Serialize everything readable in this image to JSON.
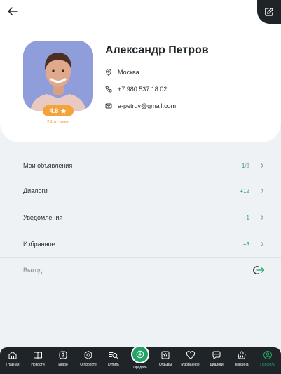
{
  "header": {
    "back_icon": "arrow-left-icon",
    "edit_icon": "edit-icon"
  },
  "profile": {
    "name": "Александр Петров",
    "rating": "4.8",
    "reviews": "24 отзыва",
    "city": "Москва",
    "phone": "+7 980 537 18 02",
    "email": "a-petrov@gmail.com"
  },
  "menu": {
    "items": [
      {
        "label": "Мои объявления",
        "count_active": "1",
        "count_rest": "/3"
      },
      {
        "label": "Диалоги",
        "count_active": "+12",
        "count_rest": ""
      },
      {
        "label": "Уведомления",
        "count_active": "+1",
        "count_rest": ""
      },
      {
        "label": "Избранное",
        "count_active": "+3",
        "count_rest": ""
      }
    ],
    "logout_label": "Выход"
  },
  "nav": {
    "items": [
      {
        "label": "Главная",
        "icon": "home-icon"
      },
      {
        "label": "Новости",
        "icon": "news-icon"
      },
      {
        "label": "Инфо",
        "icon": "info-icon"
      },
      {
        "label": "О проекте",
        "icon": "about-icon"
      },
      {
        "label": "Купить",
        "icon": "buy-search-icon"
      },
      {
        "label": "Отзывы",
        "icon": "reviews-icon"
      },
      {
        "label": "Избранное",
        "icon": "heart-icon"
      },
      {
        "label": "Диалоги",
        "icon": "chat-icon"
      },
      {
        "label": "Корзина",
        "icon": "cart-icon"
      },
      {
        "label": "Профиль",
        "icon": "profile-icon"
      }
    ],
    "sell_label": "Продать",
    "active": "Профиль"
  },
  "colors": {
    "accent": "#21a366",
    "rating": "#f2a43a",
    "dark": "#1f2428",
    "background": "#eef2f5"
  }
}
